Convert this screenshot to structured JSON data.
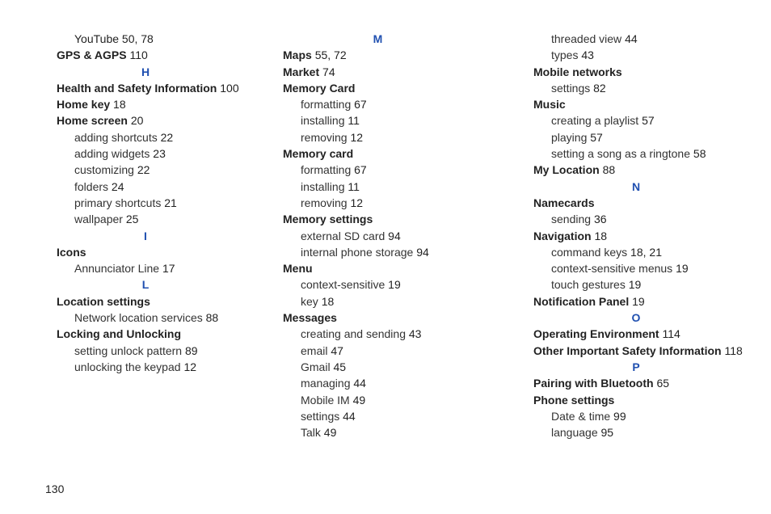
{
  "page_number": "130",
  "col1": {
    "youtube": {
      "label": "YouTube",
      "p1": "50",
      "sep": ",",
      "p2": "78"
    },
    "gps": {
      "label": "GPS & AGPS",
      "p1": "110"
    },
    "letter_h": "H",
    "health": {
      "label": "Health and Safety Information",
      "p1": "100"
    },
    "homekey": {
      "label": "Home key",
      "p1": "18"
    },
    "homescreen": {
      "label": "Home screen",
      "p1": "20"
    },
    "hs_addshortcuts": {
      "label": "adding shortcuts",
      "p1": "22"
    },
    "hs_addwidgets": {
      "label": "adding widgets",
      "p1": "23"
    },
    "hs_customizing": {
      "label": "customizing",
      "p1": "22"
    },
    "hs_folders": {
      "label": "folders",
      "p1": "24"
    },
    "hs_primary": {
      "label": "primary shortcuts",
      "p1": "21"
    },
    "hs_wallpaper": {
      "label": "wallpaper",
      "p1": "25"
    },
    "letter_i": "I",
    "icons": {
      "label": "Icons"
    },
    "icons_annunc": {
      "label": "Annunciator Line",
      "p1": "17"
    },
    "letter_l": "L",
    "locsettings": {
      "label": "Location settings"
    },
    "loc_network": {
      "label": "Network location services",
      "p1": "88"
    },
    "locking": {
      "label": "Locking and Unlocking"
    },
    "lock_pattern": {
      "label": "setting unlock pattern",
      "p1": "89"
    },
    "lock_keypad": {
      "label": "unlocking the keypad",
      "p1": "12"
    }
  },
  "col2": {
    "letter_m": "M",
    "maps": {
      "label": "Maps",
      "p1": "55",
      "sep": ",",
      "p2": "72"
    },
    "market": {
      "label": "Market",
      "p1": "74"
    },
    "memcard1": {
      "label": "Memory Card"
    },
    "mc1_format": {
      "label": "formatting",
      "p1": "67"
    },
    "mc1_install": {
      "label": "installing",
      "p1": "11"
    },
    "mc1_remove": {
      "label": "removing",
      "p1": "12"
    },
    "memcard2": {
      "label": "Memory card"
    },
    "mc2_format": {
      "label": "formatting",
      "p1": "67"
    },
    "mc2_install": {
      "label": "installing",
      "p1": "11"
    },
    "mc2_remove": {
      "label": "removing",
      "p1": "12"
    },
    "memset": {
      "label": "Memory settings"
    },
    "ms_external": {
      "label": "external SD card",
      "p1": "94"
    },
    "ms_internal": {
      "label": "internal phone storage",
      "p1": "94"
    },
    "menu": {
      "label": "Menu"
    },
    "menu_context": {
      "label": "context-sensitive",
      "p1": "19"
    },
    "menu_key": {
      "label": "key",
      "p1": "18"
    },
    "messages": {
      "label": "Messages"
    },
    "msg_create": {
      "label": "creating and sending",
      "p1": "43"
    },
    "msg_email": {
      "label": "email",
      "p1": "47"
    },
    "msg_gmail": {
      "label": "Gmail",
      "p1": "45"
    },
    "msg_manage": {
      "label": "managing",
      "p1": "44"
    },
    "msg_mobileim": {
      "label": "Mobile IM",
      "p1": "49"
    },
    "msg_settings": {
      "label": "settings",
      "p1": "44"
    },
    "msg_talk": {
      "label": "Talk",
      "p1": "49"
    }
  },
  "col3": {
    "msg_threaded": {
      "label": "threaded view",
      "p1": "44"
    },
    "msg_types": {
      "label": "types",
      "p1": "43"
    },
    "mobnet": {
      "label": "Mobile networks"
    },
    "mn_settings": {
      "label": "settings",
      "p1": "82"
    },
    "music": {
      "label": "Music"
    },
    "mu_playlist": {
      "label": "creating a playlist",
      "p1": "57"
    },
    "mu_playing": {
      "label": "playing",
      "p1": "57"
    },
    "mu_ringtone": {
      "label": "setting a song as a ringtone",
      "p1": "58"
    },
    "myloc": {
      "label": "My Location",
      "p1": "88"
    },
    "letter_n": "N",
    "namecards": {
      "label": "Namecards"
    },
    "nc_sending": {
      "label": "sending",
      "p1": "36"
    },
    "navigation": {
      "label": "Navigation",
      "p1": "18"
    },
    "nav_cmdkeys": {
      "label": "command keys",
      "p1": "18",
      "sep": ",",
      "p2": "21"
    },
    "nav_context": {
      "label": "context-sensitive menus",
      "p1": "19"
    },
    "nav_touch": {
      "label": "touch gestures",
      "p1": "19"
    },
    "notifpanel": {
      "label": "Notification Panel",
      "p1": "19"
    },
    "letter_o": "O",
    "openv": {
      "label": "Operating Environment",
      "p1": "114"
    },
    "othersafety": {
      "label": "Other Important Safety Information",
      "p1": "118"
    },
    "letter_p": "P",
    "pairing": {
      "label": "Pairing with Bluetooth",
      "p1": "65"
    },
    "phoneset": {
      "label": "Phone settings"
    },
    "ps_datetime": {
      "label": "Date & time",
      "p1": "99"
    },
    "ps_language": {
      "label": "language",
      "p1": "95"
    }
  }
}
